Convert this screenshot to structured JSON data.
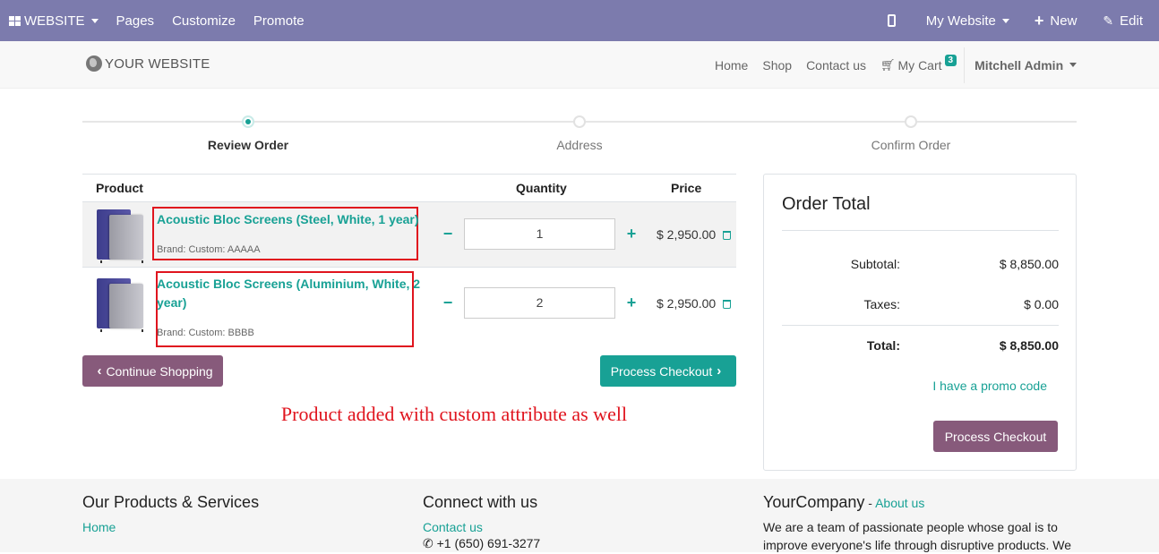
{
  "admin_bar": {
    "website_menu": "WEBSITE",
    "pages": "Pages",
    "customize": "Customize",
    "promote": "Promote",
    "my_website": "My Website",
    "new": "New",
    "edit": "Edit"
  },
  "header": {
    "logo": "YOUR WEBSITE",
    "nav": [
      "Home",
      "Shop",
      "Contact us"
    ],
    "cart_label": "My Cart",
    "cart_count": "3",
    "user": "Mitchell Admin"
  },
  "wizard": {
    "steps": [
      "Review Order",
      "Address",
      "Confirm Order"
    ],
    "active_step": "Review Order"
  },
  "cart": {
    "columns": {
      "product": "Product",
      "quantity": "Quantity",
      "price": "Price"
    },
    "rows": [
      {
        "name": "Acoustic Bloc Screens (Steel, White, 1 year)",
        "brand": "Brand: Custom: AAAAA",
        "quantity": "1",
        "price": "$ 2,950.00"
      },
      {
        "name_line1": "Acoustic Bloc Screens (Aluminium, White, 2",
        "name_line2": "year)",
        "brand": "Brand: Custom: BBBB",
        "quantity": "2",
        "price": "$ 2,950.00"
      }
    ],
    "continue_shopping": "Continue Shopping",
    "process_checkout": "Process Checkout"
  },
  "annotation": "Product added with custom attribute as well",
  "order_total": {
    "title": "Order Total",
    "subtotal_label": "Subtotal:",
    "subtotal_value": "$ 8,850.00",
    "taxes_label": "Taxes:",
    "taxes_value": "$ 0.00",
    "total_label": "Total:",
    "total_value": "$ 8,850.00",
    "promo_link": "I have a promo code",
    "process_checkout": "Process Checkout"
  },
  "footer": {
    "col1_title": "Our Products & Services",
    "col1_link": "Home",
    "col2_title": "Connect with us",
    "col2_link": "Contact us",
    "col2_phone": "+1 (650) 691-3277",
    "col3_title": "YourCompany",
    "col3_sep": " - ",
    "col3_link": "About us",
    "col3_text_line1": "We are a team of passionate people whose goal is to",
    "col3_text_line2": "improve everyone's life through disruptive products. We"
  },
  "colors": {
    "admin_bar": "#7c7bad",
    "primary_teal": "#18a195",
    "secondary_purple": "#875a7b",
    "annotation_red": "#e0141e"
  }
}
